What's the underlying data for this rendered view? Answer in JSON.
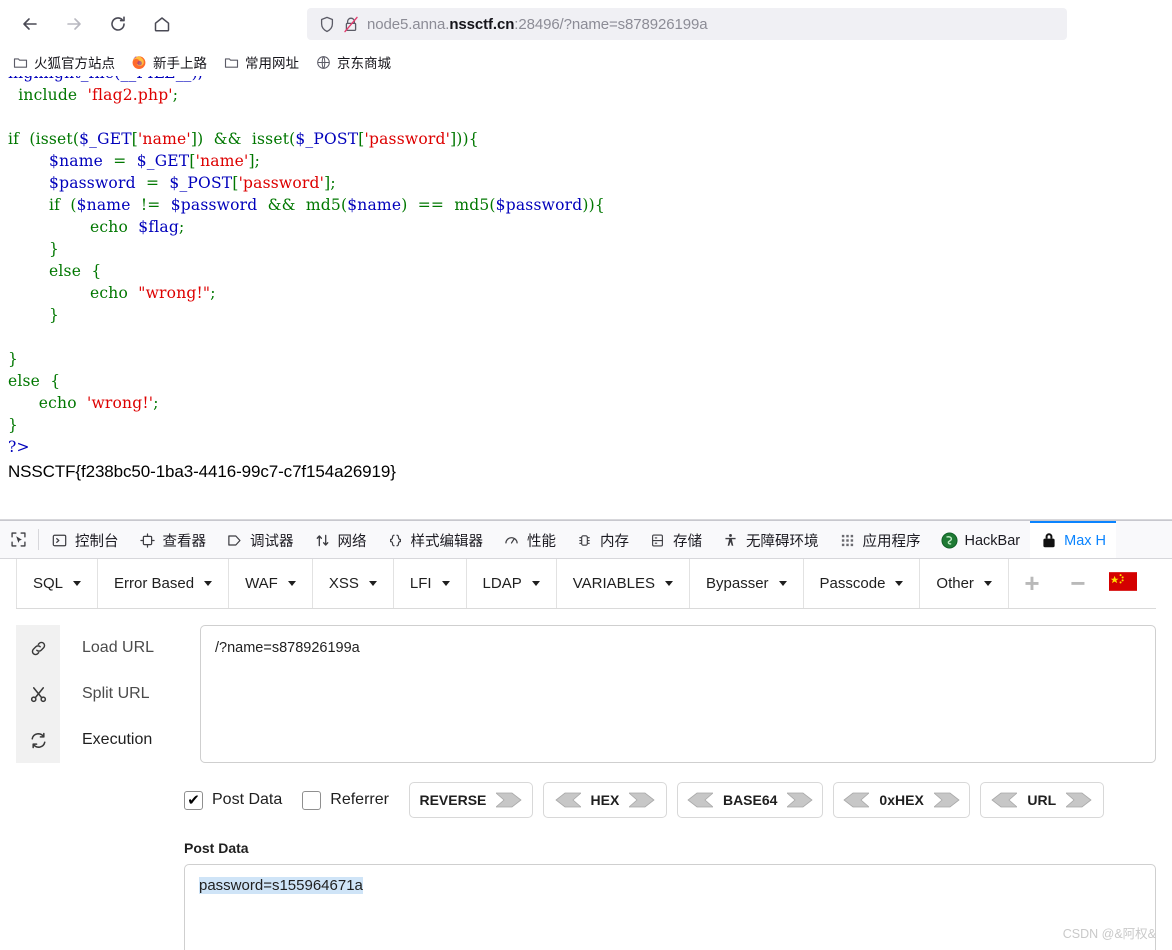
{
  "browser": {
    "nav": {
      "back_icon": "arrow-left-icon",
      "forward_icon": "arrow-right-icon",
      "reload_icon": "reload-icon",
      "home_icon": "home-icon"
    },
    "urlbar": {
      "shield_icon": "shield-icon",
      "security_icon": "lock-broken-icon",
      "url_prefix": "node5.anna.",
      "url_host_strong": "nssctf.cn",
      "url_suffix": ":28496/?name=s878926199a",
      "full_url": "node5.anna.nssctf.cn:28496/?name=s878926199a"
    },
    "bookmarks": [
      {
        "label": "火狐官方站点",
        "icon": "folder-icon"
      },
      {
        "label": "新手上路",
        "icon": "firefox-icon"
      },
      {
        "label": "常用网址",
        "icon": "folder-icon"
      },
      {
        "label": "京东商城",
        "icon": "globe-icon"
      }
    ]
  },
  "page": {
    "code_lines": [
      {
        "segments": [
          {
            "t": "highlight_file(__FILE__);",
            "c": "c-var"
          }
        ]
      },
      {
        "segments": [
          {
            "t": "  include  ",
            "c": "c-kw"
          },
          {
            "t": "'flag2.php'",
            "c": "c-str"
          },
          {
            "t": ";",
            "c": "c-kw"
          }
        ]
      },
      {
        "segments": [
          {
            "t": "",
            "c": "c-kw"
          }
        ]
      },
      {
        "segments": [
          {
            "t": "if  (isset(",
            "c": "c-kw"
          },
          {
            "t": "$_GET",
            "c": "c-var"
          },
          {
            "t": "[",
            "c": "c-kw"
          },
          {
            "t": "'name'",
            "c": "c-str"
          },
          {
            "t": "])  &&  isset(",
            "c": "c-kw"
          },
          {
            "t": "$_POST",
            "c": "c-var"
          },
          {
            "t": "[",
            "c": "c-kw"
          },
          {
            "t": "'password'",
            "c": "c-str"
          },
          {
            "t": "])){",
            "c": "c-kw"
          }
        ]
      },
      {
        "segments": [
          {
            "t": "        ",
            "c": "c-kw"
          },
          {
            "t": "$name",
            "c": "c-var"
          },
          {
            "t": "  =  ",
            "c": "c-kw"
          },
          {
            "t": "$_GET",
            "c": "c-var"
          },
          {
            "t": "[",
            "c": "c-kw"
          },
          {
            "t": "'name'",
            "c": "c-str"
          },
          {
            "t": "];",
            "c": "c-kw"
          }
        ]
      },
      {
        "segments": [
          {
            "t": "        ",
            "c": "c-kw"
          },
          {
            "t": "$password",
            "c": "c-var"
          },
          {
            "t": "  =  ",
            "c": "c-kw"
          },
          {
            "t": "$_POST",
            "c": "c-var"
          },
          {
            "t": "[",
            "c": "c-kw"
          },
          {
            "t": "'password'",
            "c": "c-str"
          },
          {
            "t": "];",
            "c": "c-kw"
          }
        ]
      },
      {
        "segments": [
          {
            "t": "        if  (",
            "c": "c-kw"
          },
          {
            "t": "$name",
            "c": "c-var"
          },
          {
            "t": "  !=  ",
            "c": "c-kw"
          },
          {
            "t": "$password",
            "c": "c-var"
          },
          {
            "t": "  &&  md5(",
            "c": "c-kw"
          },
          {
            "t": "$name",
            "c": "c-var"
          },
          {
            "t": ")  ==  md5(",
            "c": "c-kw"
          },
          {
            "t": "$password",
            "c": "c-var"
          },
          {
            "t": ")){",
            "c": "c-kw"
          }
        ]
      },
      {
        "segments": [
          {
            "t": "                echo  ",
            "c": "c-kw"
          },
          {
            "t": "$flag",
            "c": "c-var"
          },
          {
            "t": ";",
            "c": "c-kw"
          }
        ]
      },
      {
        "segments": [
          {
            "t": "        }",
            "c": "c-kw"
          }
        ]
      },
      {
        "segments": [
          {
            "t": "        else  {",
            "c": "c-kw"
          }
        ]
      },
      {
        "segments": [
          {
            "t": "                echo  ",
            "c": "c-kw"
          },
          {
            "t": "\"wrong!\"",
            "c": "c-str"
          },
          {
            "t": ";",
            "c": "c-kw"
          }
        ]
      },
      {
        "segments": [
          {
            "t": "        }",
            "c": "c-kw"
          }
        ]
      },
      {
        "segments": [
          {
            "t": "",
            "c": "c-kw"
          }
        ]
      },
      {
        "segments": [
          {
            "t": "}",
            "c": "c-kw"
          }
        ]
      },
      {
        "segments": [
          {
            "t": "else  {",
            "c": "c-kw"
          }
        ]
      },
      {
        "segments": [
          {
            "t": "      echo  ",
            "c": "c-kw"
          },
          {
            "t": "'wrong!'",
            "c": "c-str"
          },
          {
            "t": ";",
            "c": "c-kw"
          }
        ]
      },
      {
        "segments": [
          {
            "t": "}",
            "c": "c-kw"
          }
        ]
      },
      {
        "segments": [
          {
            "t": "?>",
            "c": "c-tag"
          }
        ]
      }
    ],
    "flag": "NSSCTF{f238bc50-1ba3-4416-99c7-c7f154a26919}"
  },
  "devtools": {
    "picker_icon": "element-picker-icon",
    "tabs": [
      {
        "label": "控制台",
        "icon": "console-icon",
        "selected": false
      },
      {
        "label": "查看器",
        "icon": "inspector-icon",
        "selected": false
      },
      {
        "label": "调试器",
        "icon": "debugger-icon",
        "selected": false
      },
      {
        "label": "网络",
        "icon": "network-icon",
        "selected": false
      },
      {
        "label": "样式编辑器",
        "icon": "style-editor-icon",
        "selected": false
      },
      {
        "label": "性能",
        "icon": "performance-icon",
        "selected": false
      },
      {
        "label": "内存",
        "icon": "memory-icon",
        "selected": false
      },
      {
        "label": "存储",
        "icon": "storage-icon",
        "selected": false
      },
      {
        "label": "无障碍环境",
        "icon": "accessibility-icon",
        "selected": false
      },
      {
        "label": "应用程序",
        "icon": "application-icon",
        "selected": false
      },
      {
        "label": "HackBar",
        "icon": "hackbar-icon",
        "selected": false
      },
      {
        "label": "Max H",
        "icon": "padlock-icon",
        "selected": true
      }
    ]
  },
  "hackbar": {
    "menus": [
      {
        "label": "SQL"
      },
      {
        "label": "Error Based"
      },
      {
        "label": "WAF"
      },
      {
        "label": "XSS"
      },
      {
        "label": "LFI"
      },
      {
        "label": "LDAP"
      },
      {
        "label": "VARIABLES"
      },
      {
        "label": "Bypasser"
      },
      {
        "label": "Passcode"
      },
      {
        "label": "Other"
      }
    ],
    "add_label": "+",
    "remove_label": "−",
    "flag_icon": "china-flag-icon",
    "actions": [
      {
        "label": "Load URL",
        "icon": "link-icon"
      },
      {
        "label": "Split URL",
        "icon": "scissors-icon"
      },
      {
        "label": "Execution",
        "icon": "refresh-icon"
      }
    ],
    "url_value": "/?name=s878926199a",
    "url_placeholder": "",
    "post_data_checkbox": {
      "label": "Post Data",
      "checked": true,
      "check_glyph": "✔"
    },
    "referrer_checkbox": {
      "label": "Referrer",
      "checked": false,
      "check_glyph": ""
    },
    "encoders": [
      {
        "label": "REVERSE",
        "left_chevron": false,
        "right_chevron": true
      },
      {
        "label": "HEX",
        "left_chevron": true,
        "right_chevron": true
      },
      {
        "label": "BASE64",
        "left_chevron": true,
        "right_chevron": true
      },
      {
        "label": "0xHEX",
        "left_chevron": true,
        "right_chevron": true
      },
      {
        "label": "URL",
        "left_chevron": true,
        "right_chevron": true
      }
    ],
    "post_label": "Post Data",
    "post_value": "password=s155964671a",
    "post_placeholder": ""
  },
  "watermark": "CSDN @&阿权&",
  "colors": {
    "accent_blue": "#0a84ff",
    "code_keyword": "#007700",
    "code_string": "#dd0000",
    "code_var": "#0000bb",
    "flag_red": "#cc0000"
  }
}
